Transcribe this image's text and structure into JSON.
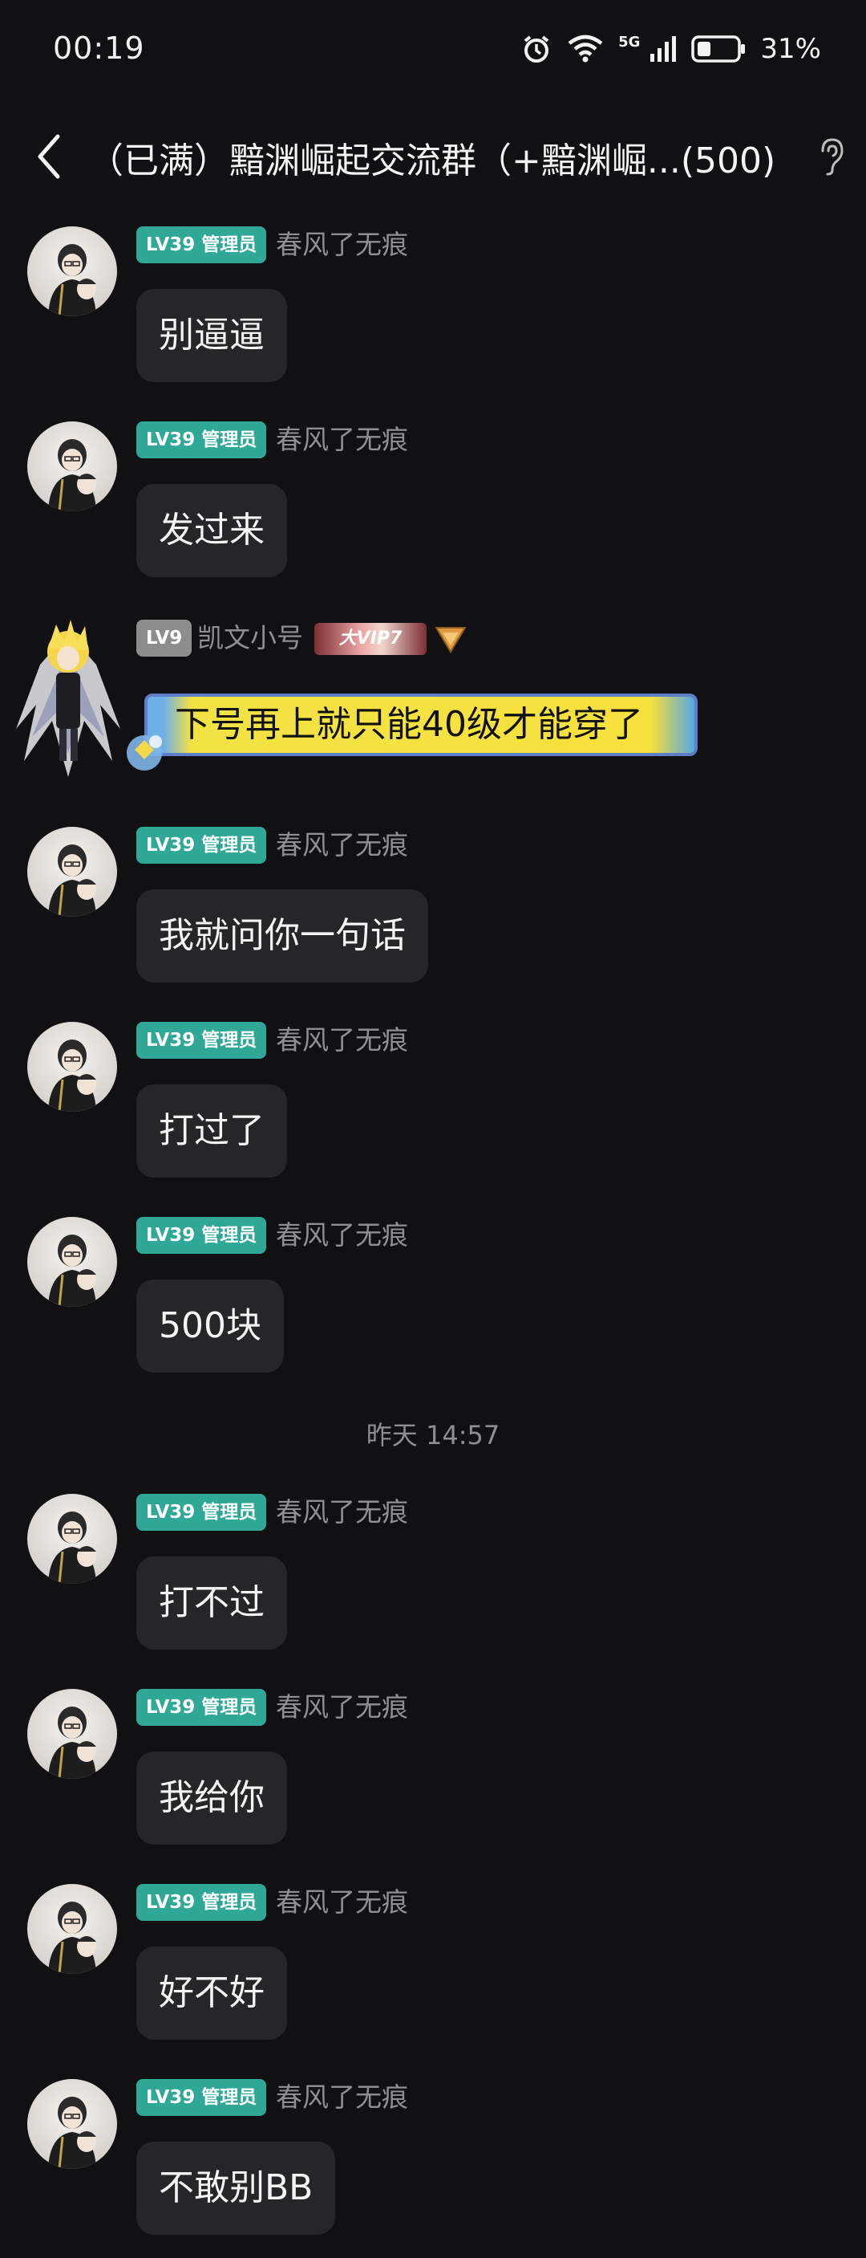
{
  "status_bar": {
    "time": "00:19",
    "network": "5G",
    "battery": "31%",
    "icons": [
      "alarm-icon",
      "wifi-icon",
      "signal-icon",
      "battery-icon"
    ]
  },
  "header": {
    "title": "（已满）黯渊崛起交流群（+黯渊崛...(500)",
    "back_icon": "chevron-left-icon",
    "right_icon": "ear-icon"
  },
  "messages": [
    {
      "level": "LV39 管理员",
      "name": "春风了无痕",
      "text": "别逼逼"
    },
    {
      "level": "LV39 管理员",
      "name": "春风了无痕",
      "text": "发过来"
    },
    {
      "level": "LV9",
      "name": "凯文小号",
      "vip": "大VIP7",
      "text": "下号再上就只能40级才能穿了"
    },
    {
      "level": "LV39 管理员",
      "name": "春风了无痕",
      "text": "我就问你一句话"
    },
    {
      "level": "LV39 管理员",
      "name": "春风了无痕",
      "text": "打过了"
    },
    {
      "level": "LV39 管理员",
      "name": "春风了无痕",
      "text": "500块"
    },
    {
      "level": "LV39 管理员",
      "name": "春风了无痕",
      "text": "打不过"
    },
    {
      "level": "LV39 管理员",
      "name": "春风了无痕",
      "text": "我给你"
    },
    {
      "level": "LV39 管理员",
      "name": "春风了无痕",
      "text": "好不好"
    },
    {
      "level": "LV39 管理员",
      "name": "春风了无痕",
      "text": "不敢别BB"
    }
  ],
  "timestamp": "昨天 14:57",
  "colors": {
    "background": "#111113",
    "bubble": "#262628",
    "badge_admin": "#2fa898",
    "nickname": "#8e8e93"
  }
}
